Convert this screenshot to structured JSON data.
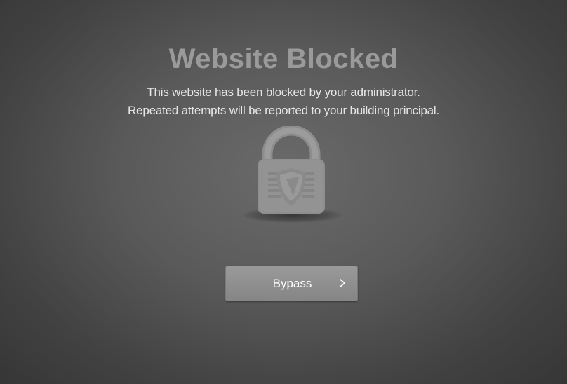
{
  "page": {
    "title": "Website Blocked",
    "message_line1": "This website has been blocked by your administrator.",
    "message_line2": "Repeated attempts will be reported to your building principal."
  },
  "lock": {
    "icon": "padlock-icon",
    "emblem": "shield-icon"
  },
  "bypass": {
    "label": "Bypass",
    "chevron_icon": "chevron-right-icon"
  },
  "colors": {
    "background_center": "#6a6a6a",
    "background_edge": "#363636",
    "title": "#9a9a9a",
    "message": "#e6e6e6",
    "button": "#8f8f8f"
  }
}
